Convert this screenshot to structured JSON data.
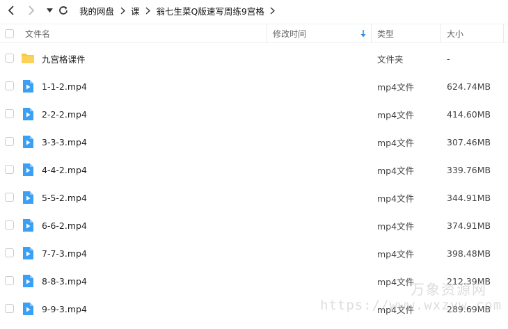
{
  "breadcrumb": [
    "我的网盘",
    "课",
    "翁七生菜Q版速写周练9宫格"
  ],
  "header": {
    "name": "文件名",
    "modified": "修改时间",
    "type": "类型",
    "size": "大小"
  },
  "files": [
    {
      "name": "九宫格课件",
      "type": "文件夹",
      "size": "-",
      "icon": "folder-icon"
    },
    {
      "name": "1-1-2.mp4",
      "type": "mp4文件",
      "size": "624.74MB",
      "icon": "video-file-icon"
    },
    {
      "name": "2-2-2.mp4",
      "type": "mp4文件",
      "size": "414.60MB",
      "icon": "video-file-icon"
    },
    {
      "name": "3-3-3.mp4",
      "type": "mp4文件",
      "size": "307.46MB",
      "icon": "video-file-icon"
    },
    {
      "name": "4-4-2.mp4",
      "type": "mp4文件",
      "size": "339.76MB",
      "icon": "video-file-icon"
    },
    {
      "name": "5-5-2.mp4",
      "type": "mp4文件",
      "size": "344.91MB",
      "icon": "video-file-icon"
    },
    {
      "name": "6-6-2.mp4",
      "type": "mp4文件",
      "size": "374.91MB",
      "icon": "video-file-icon"
    },
    {
      "name": "7-7-3.mp4",
      "type": "mp4文件",
      "size": "398.48MB",
      "icon": "video-file-icon"
    },
    {
      "name": "8-8-3.mp4",
      "type": "mp4文件",
      "size": "212.39MB",
      "icon": "video-file-icon"
    },
    {
      "name": "9-9-3.mp4",
      "type": "mp4文件",
      "size": "289.69MB",
      "icon": "video-file-icon"
    }
  ],
  "watermark": {
    "line1": "万象资源网",
    "line2": "https://www.wxzyw.com"
  },
  "colors": {
    "folder": "#f7c945",
    "video": "#3aa0f5",
    "sort_arrow": "#2c8cf0"
  }
}
